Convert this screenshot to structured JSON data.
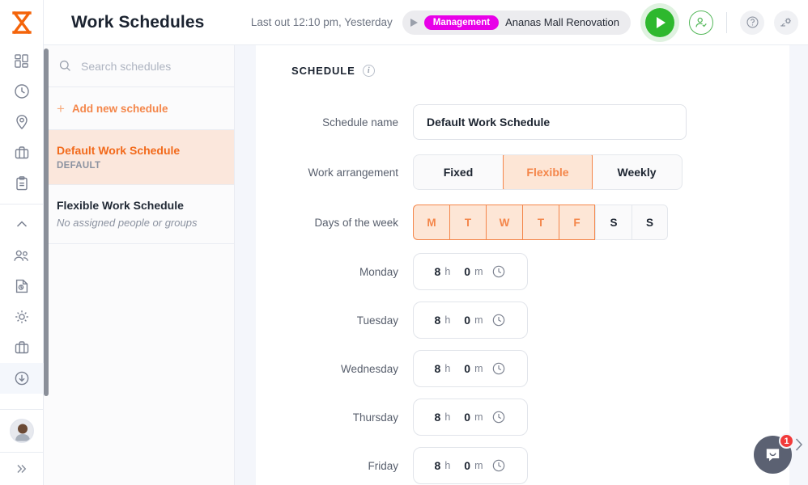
{
  "app": {
    "logo_icon": "hourglass-logo",
    "accent_orange": "#f4864a",
    "accent_magenta": "#e800e8",
    "accent_green": "#2eb82e"
  },
  "rail": {
    "items": [
      {
        "icon": "dashboard-icon",
        "name": "dashboard"
      },
      {
        "icon": "clock-icon",
        "name": "time-tracking"
      },
      {
        "icon": "location-pin-icon",
        "name": "locations"
      },
      {
        "icon": "briefcase-icon",
        "name": "projects"
      },
      {
        "icon": "clipboard-icon",
        "name": "tasks"
      },
      {
        "icon": "chevron-up-icon",
        "name": "collapse-group"
      },
      {
        "icon": "people-icon",
        "name": "people"
      },
      {
        "icon": "report-clock-icon",
        "name": "reports"
      },
      {
        "icon": "settings-sun-icon",
        "name": "settings"
      },
      {
        "icon": "briefcase-icon",
        "name": "work"
      },
      {
        "icon": "download-icon",
        "name": "downloads"
      }
    ],
    "expand_icon": "chevrons-right-icon",
    "avatar_name": "user-avatar"
  },
  "header": {
    "title": "Work Schedules",
    "last_out": "Last out 12:10 pm, Yesterday",
    "task_pill": {
      "play_icon": "play-small-icon",
      "badge": "Management",
      "task_name": "Ananas Mall Renovation"
    },
    "start_timer_icon": "play-circle-icon",
    "assign_icon": "person-check-icon",
    "help_icon": "help-circle-icon",
    "settings_icon": "settings-hand-icon"
  },
  "list": {
    "search_placeholder": "Search schedules",
    "search_icon": "search-icon",
    "add_label": "Add new schedule",
    "add_icon": "plus-icon",
    "items": [
      {
        "name": "Default Work Schedule",
        "sub": "DEFAULT",
        "selected": true,
        "italic_sub": false
      },
      {
        "name": "Flexible Work Schedule",
        "sub": "No assigned people or groups",
        "selected": false,
        "italic_sub": true
      }
    ]
  },
  "form": {
    "section_title": "SCHEDULE",
    "info_icon": "info-icon",
    "schedule_name": {
      "label": "Schedule name",
      "value": "Default Work Schedule"
    },
    "work_arrangement": {
      "label": "Work arrangement",
      "options": [
        "Fixed",
        "Flexible",
        "Weekly"
      ],
      "selected": "Flexible"
    },
    "days_of_week": {
      "label": "Days of the week",
      "days": [
        {
          "letter": "M",
          "on": true
        },
        {
          "letter": "T",
          "on": true
        },
        {
          "letter": "W",
          "on": true
        },
        {
          "letter": "T",
          "on": true
        },
        {
          "letter": "F",
          "on": true
        },
        {
          "letter": "S",
          "on": false
        },
        {
          "letter": "S",
          "on": false
        }
      ]
    },
    "durations": [
      {
        "label": "Monday",
        "hours": "8",
        "h_unit": "h",
        "minutes": "0",
        "m_unit": "m",
        "icon": "clock-icon"
      },
      {
        "label": "Tuesday",
        "hours": "8",
        "h_unit": "h",
        "minutes": "0",
        "m_unit": "m",
        "icon": "clock-icon"
      },
      {
        "label": "Wednesday",
        "hours": "8",
        "h_unit": "h",
        "minutes": "0",
        "m_unit": "m",
        "icon": "clock-icon"
      },
      {
        "label": "Thursday",
        "hours": "8",
        "h_unit": "h",
        "minutes": "0",
        "m_unit": "m",
        "icon": "clock-icon"
      },
      {
        "label": "Friday",
        "hours": "8",
        "h_unit": "h",
        "minutes": "0",
        "m_unit": "m",
        "icon": "clock-icon"
      }
    ]
  },
  "chat": {
    "icon": "chat-bubble-icon",
    "unread": "1",
    "panel_chevron_icon": "chevron-right-icon"
  }
}
